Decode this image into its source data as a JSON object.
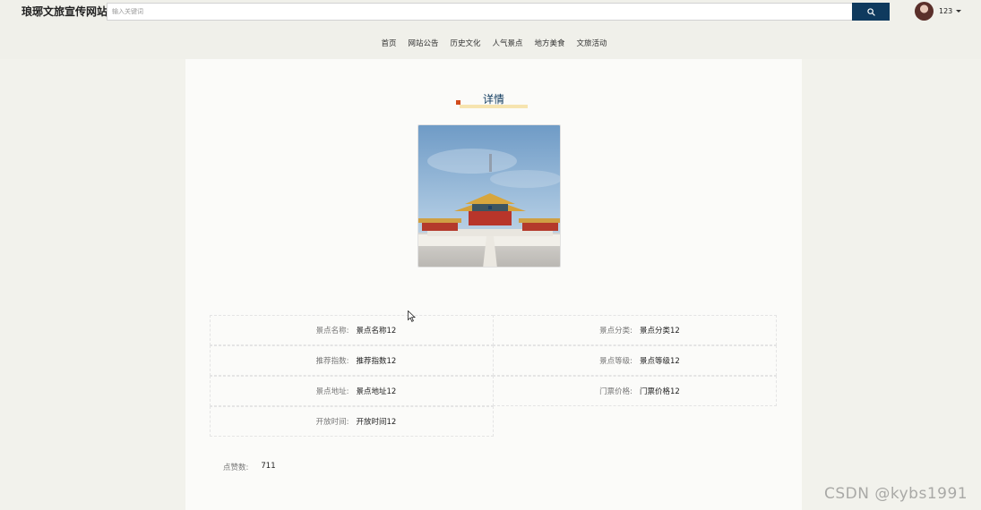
{
  "header": {
    "site_title": "琅琊文旅宣传网站",
    "search_placeholder": "输入关键词",
    "search_icon": "search-icon",
    "username": "123"
  },
  "nav": {
    "items": [
      "首页",
      "网站公告",
      "历史文化",
      "人气景点",
      "地方美食",
      "文旅活动"
    ]
  },
  "detail": {
    "title": "详情",
    "image_alt": "故宫太和殿",
    "rows": [
      [
        {
          "label": "景点名称:",
          "value": "景点名称12"
        },
        {
          "label": "景点分类:",
          "value": "景点分类12"
        }
      ],
      [
        {
          "label": "推荐指数:",
          "value": "推荐指数12"
        },
        {
          "label": "景点等级:",
          "value": "景点等级12"
        }
      ],
      [
        {
          "label": "景点地址:",
          "value": "景点地址12"
        },
        {
          "label": "门票价格:",
          "value": "门票价格12"
        }
      ],
      [
        {
          "label": "开放时间:",
          "value": "开放时间12"
        }
      ]
    ],
    "likes_label": "点赞数:",
    "likes_value": "711"
  },
  "watermark": "CSDN @kybs1991",
  "colors": {
    "accent": "#0f3a5e",
    "title_mark": "#d14b1c",
    "title_underline": "#f6e4b0"
  }
}
